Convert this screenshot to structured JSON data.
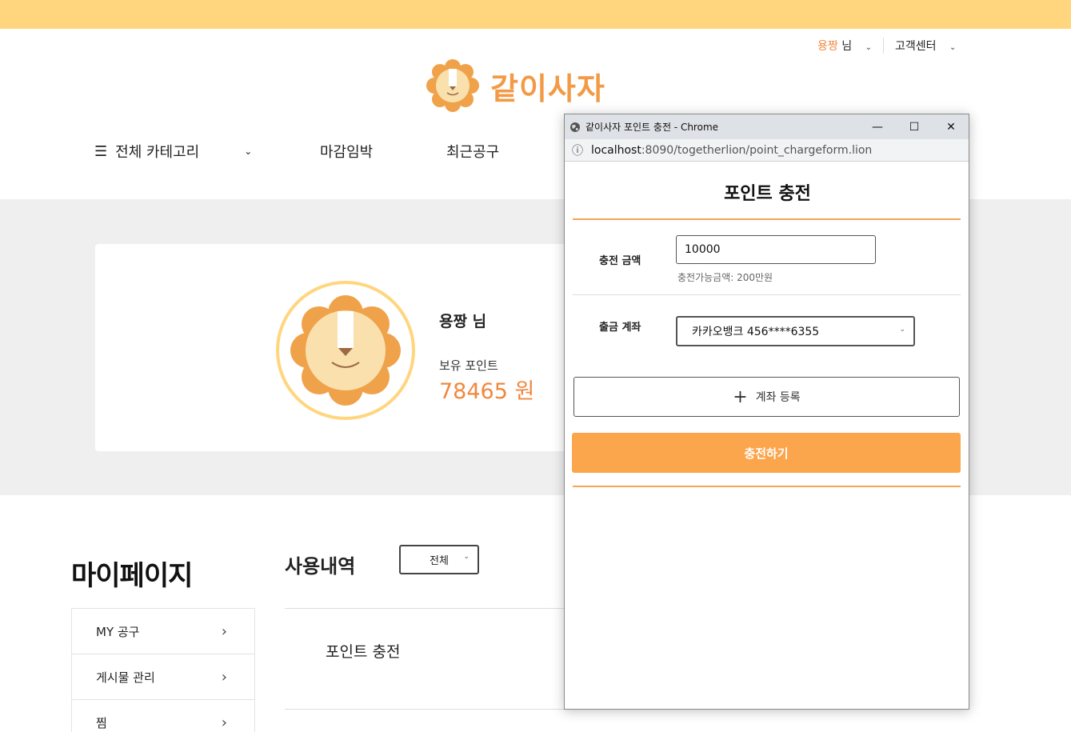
{
  "header": {
    "user_name": "용짱",
    "user_suffix": " 님",
    "customer_center": "고객센터",
    "logo_text": "같이사자"
  },
  "nav": {
    "all_categories": "전체 카테고리",
    "items": [
      "마감임박",
      "최근공구"
    ]
  },
  "profile": {
    "name": "용짱 님",
    "points_label": "보유 포인트",
    "points_value": "78465 원"
  },
  "mypage": {
    "title": "마이페이지",
    "menu": [
      "MY 공구",
      "게시물 관리",
      "찜"
    ]
  },
  "history": {
    "title": "사용내역",
    "filter_value": "전체",
    "items": [
      "포인트 충전"
    ]
  },
  "popup": {
    "window_title": "같이사자 포인트 충전 - Chrome",
    "url_host": "localhost",
    "url_rest": ":8090/togetherlion/point_chargeform.lion",
    "title": "포인트 충전",
    "amount_label": "충전 금액",
    "amount_value": "10000",
    "amount_hint": "충전가능금액: 200만원",
    "account_label": "출금 계좌",
    "account_value": "카카오뱅크 456****6355",
    "register_button": "계좌 등록",
    "charge_button": "충전하기"
  },
  "colors": {
    "accent": "#f0883d",
    "top_bar": "#ffd67e",
    "charge_button": "#fba54c"
  }
}
